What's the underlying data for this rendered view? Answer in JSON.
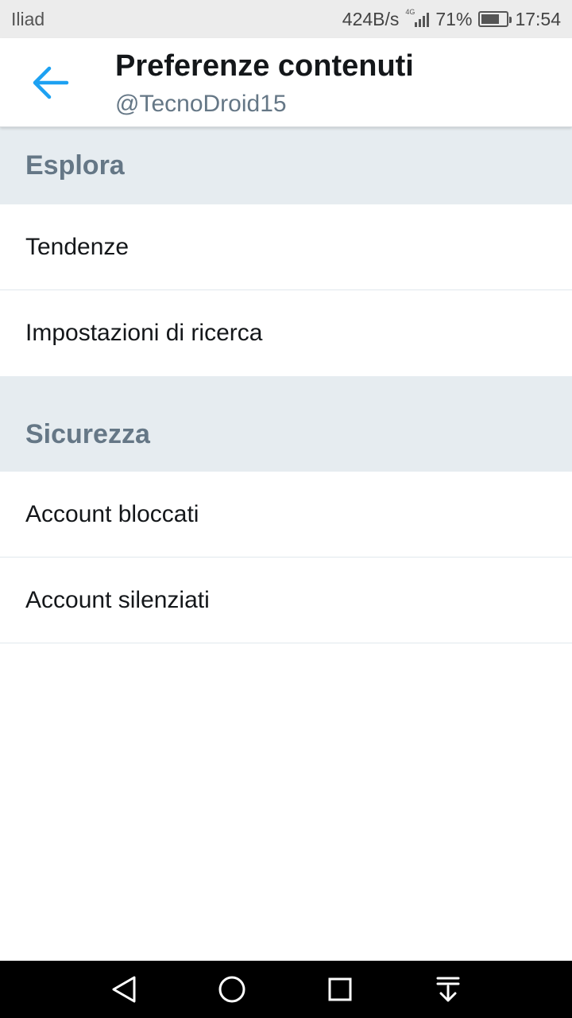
{
  "status_bar": {
    "carrier": "Iliad",
    "network_speed": "424B/s",
    "network_type": "4G",
    "battery_percent": "71%",
    "battery_level": 0.71,
    "time": "17:54"
  },
  "header": {
    "back_icon": "arrow-left-icon",
    "title": "Preferenze contenuti",
    "subtitle": "@TecnoDroid15",
    "accent_color": "#1da1f2"
  },
  "sections": [
    {
      "title": "Esplora",
      "items": [
        "Tendenze",
        "Impostazioni di ricerca"
      ]
    },
    {
      "title": "Sicurezza",
      "items": [
        "Account bloccati",
        "Account silenziati"
      ]
    }
  ],
  "nav_bar": {
    "back_icon": "triangle-back-icon",
    "home_icon": "circle-home-icon",
    "recents_icon": "square-recents-icon",
    "notifications_icon": "pull-down-icon"
  }
}
